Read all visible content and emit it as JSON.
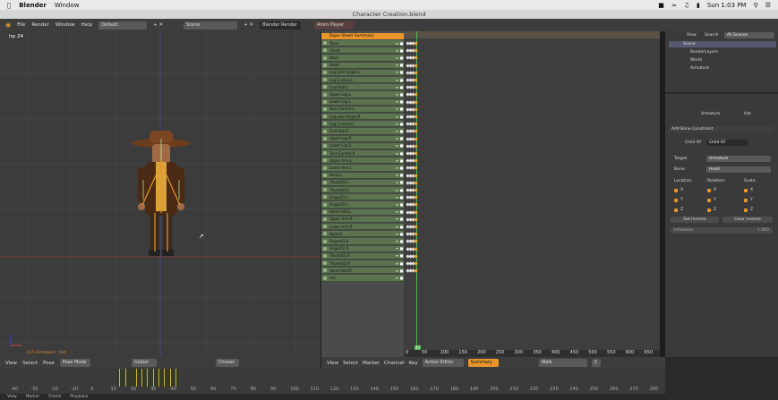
{
  "mac_menubar": {
    "apple": "",
    "app_name": "Blender",
    "window_menu": "Window",
    "clock": "Sun 1:03 PM"
  },
  "window_title": "Character Creation.blend",
  "info_header": {
    "menus": [
      "File",
      "Render",
      "Window",
      "Help"
    ],
    "layout": "Default",
    "scene": "Scene",
    "engine": "Blender Render"
  },
  "viewport": {
    "label": "lrp 24",
    "status": "(47) Armature : Hat"
  },
  "dopesheet_header": {
    "anim_player": "Anim Player",
    "summary": "Dope Sheet Summary"
  },
  "channels": [
    "Torso",
    "Chest",
    "Neck",
    "Head",
    "Leg pole target.L",
    "Leg Control.L",
    "Foot Roll.L",
    "Upper Leg.L",
    "Lower Leg.L",
    "Toes Control.L",
    "Leg pole target.R",
    "Leg Control.R",
    "Foot Roll.R",
    "Upper Leg.R",
    "Lower Leg.R",
    "Toes Control.R",
    "Upper Arm.L",
    "Lower Arm.L",
    "Hand.L",
    "Thumb01.L",
    "Thumb02.L",
    "Finger01.L",
    "Finger02.L",
    "Hand Hold.L",
    "Upper Arm.R",
    "Lower Arm.R",
    "Hand.R",
    "Finger01.R",
    "Finger02.R",
    "Thumb01.R",
    "Thumb02.R",
    "Hand Hold.R",
    "Hat"
  ],
  "dopesheet_ruler": [
    "0",
    "50",
    "100",
    "150",
    "200",
    "250",
    "300",
    "350",
    "400",
    "450",
    "500",
    "550",
    "600",
    "650"
  ],
  "current_frame": "47",
  "outliner": {
    "tabs": [
      "View",
      "Search",
      "All Scenes"
    ],
    "items": [
      "Scene",
      "RenderLayers",
      "World",
      "Armature"
    ]
  },
  "properties": {
    "context": [
      "Armature",
      "Hat"
    ],
    "add_constraint": "Add Bone Constraint",
    "constraint_type": "Child Of",
    "constraint_name": "Child Of",
    "target_label": "Target:",
    "target_value": "Armature",
    "bone_label": "Bone:",
    "bone_value": "Head",
    "location_label": "Location:",
    "rotation_label": "Rotation:",
    "scale_label": "Scale:",
    "axes": [
      "X",
      "Y",
      "Z"
    ],
    "set_inverse": "Set Inverse",
    "clear_inverse": "Clear Inverse",
    "influence_label": "Influence",
    "influence_value": "1.000"
  },
  "viewport_header": {
    "menus": [
      "View",
      "Select",
      "Pose"
    ],
    "mode": "Pose Mode",
    "pivot": "Global"
  },
  "dopesheet_bottom_header": {
    "chosen": "Chosen",
    "menus": [
      "View",
      "Select",
      "Marker",
      "Channel",
      "Key"
    ],
    "editor": "Action Editor",
    "summary_btn": "Summary",
    "action_name": "Walk",
    "users": "2"
  },
  "timeline_ruler": [
    "-40",
    "-30",
    "-20",
    "-10",
    "0",
    "10",
    "20",
    "30",
    "40",
    "50",
    "60",
    "70",
    "80",
    "90",
    "100",
    "110",
    "120",
    "130",
    "140",
    "150",
    "160",
    "170",
    "180",
    "190",
    "200",
    "210",
    "220",
    "230",
    "240",
    "250",
    "260",
    "270",
    "280"
  ],
  "timeline_bottom": [
    "View",
    "Marker",
    "Frame",
    "Playback"
  ],
  "colors": {
    "accent_orange": "#e8962a",
    "channel_green": "#5c7450",
    "playhead_green": "#4fb84f",
    "viewport_bg": "#3c3c3c"
  }
}
